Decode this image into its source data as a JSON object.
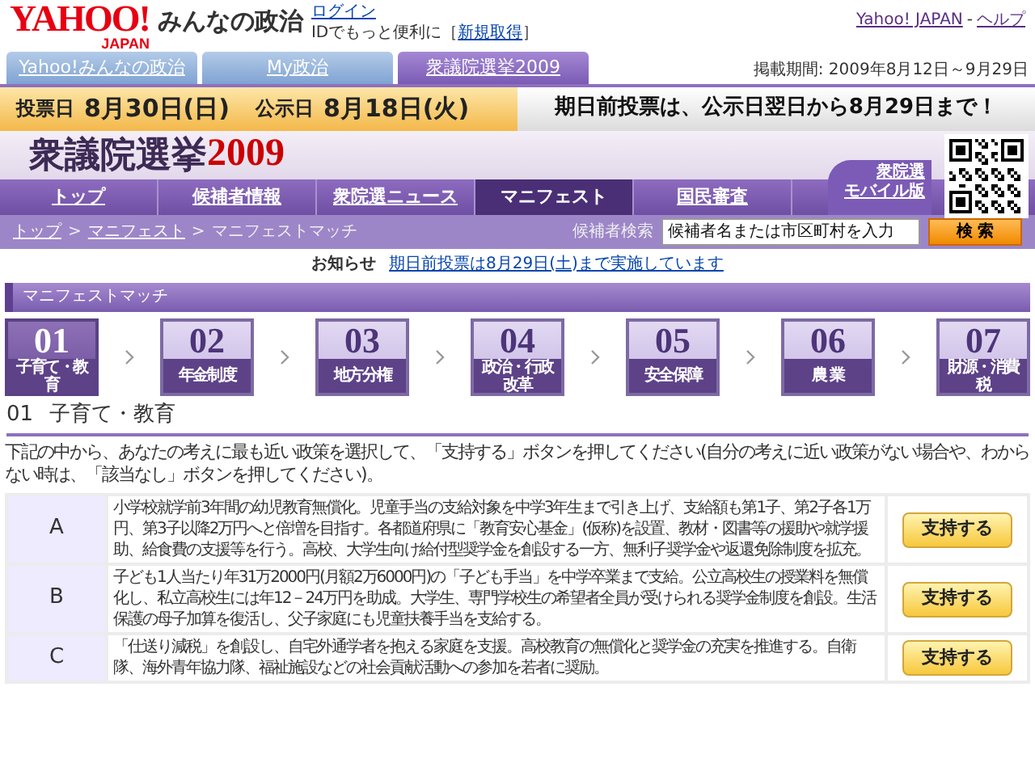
{
  "header": {
    "logo": "YAHOO!",
    "logo_sub": "JAPAN",
    "site_name": "みんなの政治",
    "login_link": "ログイン",
    "login_note_prefix": "IDでもっと便利に［",
    "signup_link": "新規取得",
    "login_note_suffix": "］",
    "top_links": [
      "Yahoo! JAPAN",
      "ヘルプ"
    ],
    "top_link_separator": "-"
  },
  "tabs": [
    {
      "label": "Yahoo!みんなの政治",
      "selected": false
    },
    {
      "label": "My政治",
      "selected": false
    },
    {
      "label": "衆議院選挙2009",
      "selected": true
    }
  ],
  "period": "掲載期間: 2009年8月12日～9月29日",
  "date_banner": {
    "vote_label": "投票日",
    "vote_date": "8月30日(日)",
    "announce_label": "公示日",
    "announce_date": "8月18日(火)",
    "early_vote": "期日前投票は、公示日翌日から8月29日まで！"
  },
  "title": {
    "main": "衆議院選挙",
    "year": "2009"
  },
  "nav": [
    {
      "label": "トップ",
      "selected": false
    },
    {
      "label": "候補者情報",
      "selected": false
    },
    {
      "label": "衆院選ニュース",
      "selected": false
    },
    {
      "label": "マニフェスト",
      "selected": true
    },
    {
      "label": "国民審査",
      "selected": false
    }
  ],
  "mobile_link": [
    "衆院選",
    "モバイル版"
  ],
  "breadcrumb": {
    "items": [
      "トップ",
      "マニフェスト",
      "マニフェストマッチ"
    ],
    "separator": ">"
  },
  "search": {
    "label": "候補者検索",
    "placeholder": "候補者名または市区町村を入力",
    "button": "検 索"
  },
  "notice": {
    "label": "お知らせ",
    "link": "期日前投票は8月29日(土)まで実施しています"
  },
  "section_title": "マニフェストマッチ",
  "steps": [
    {
      "number": "01",
      "label": "子育て・教育",
      "selected": true
    },
    {
      "number": "02",
      "label": "年金制度",
      "selected": false
    },
    {
      "number": "03",
      "label": "地方分権",
      "selected": false
    },
    {
      "number": "04",
      "label": "政治・行政改革",
      "selected": false
    },
    {
      "number": "05",
      "label": "安全保障",
      "selected": false
    },
    {
      "number": "06",
      "label": "農 業",
      "selected": false
    },
    {
      "number": "07",
      "label": "財源・消費税",
      "selected": false
    }
  ],
  "topic": {
    "number": "01",
    "title": "子育て・教育"
  },
  "instruction": "下記の中から、あなたの考えに最も近い政策を選択して、「支持する」ボタンを押してください(自分の考えに近い政策がない場合や、わからない時は、「該当なし」ボタンを押してください)。",
  "policies": [
    {
      "letter": "A",
      "text": "小学校就学前3年間の幼児教育無償化。児童手当の支給対象を中学3年生まで引き上げ、支給額も第1子、第2子各1万円、第3子以降2万円へと倍増を目指す。各都道府県に「教育安心基金」(仮称)を設置、教材・図書等の援助や就学援助、給食費の支援等を行う。高校、大学生向け給付型奨学金を創設する一方、無利子奨学金や返還免除制度を拡充。",
      "button": "支持する"
    },
    {
      "letter": "B",
      "text": "子ども1人当たり年31万2000円(月額2万6000円)の「子ども手当」を中学卒業まで支給。公立高校生の授業料を無償化し、私立高校生には年12－24万円を助成。大学生、専門学校生の希望者全員が受けられる奨学金制度を創設。生活保護の母子加算を復活し、父子家庭にも児童扶養手当を支給する。",
      "button": "支持する"
    },
    {
      "letter": "C",
      "text": "「仕送り減税」を創設し、自宅外通学者を抱える家庭を支援。高校教育の無償化と奨学金の充実を推進する。自衛隊、海外青年協力隊、福祉施設などの社会貢献活動への参加を若者に奨励。",
      "button": "支持する"
    }
  ]
}
